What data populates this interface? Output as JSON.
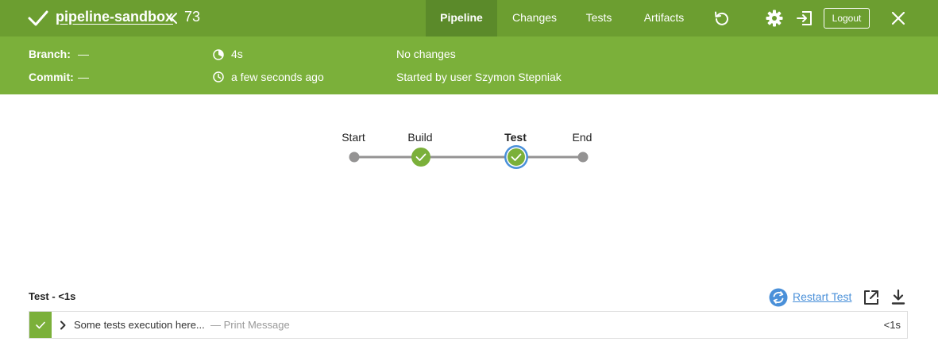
{
  "header": {
    "title": "pipeline-sandbox",
    "run_number": "73",
    "tabs": [
      {
        "label": "Pipeline",
        "active": true
      },
      {
        "label": "Changes",
        "active": false
      },
      {
        "label": "Tests",
        "active": false
      },
      {
        "label": "Artifacts",
        "active": false
      }
    ],
    "logout_label": "Logout",
    "icons": [
      "check-icon",
      "chevron-left-icon",
      "replay-icon",
      "gear-icon",
      "exit-icon",
      "close-icon"
    ]
  },
  "info": {
    "branch_label": "Branch:",
    "branch_value": "—",
    "commit_label": "Commit:",
    "commit_value": "—",
    "duration": "4s",
    "time_ago": "a few seconds ago",
    "changes": "No changes",
    "started_by": "Started by user Szymon Stepniak"
  },
  "pipeline": {
    "stages": [
      {
        "name": "Start",
        "status": "none",
        "selected": false
      },
      {
        "name": "Build",
        "status": "success",
        "selected": false
      },
      {
        "name": "Test",
        "status": "success",
        "selected": true
      },
      {
        "name": "End",
        "status": "none",
        "selected": false
      }
    ]
  },
  "log": {
    "section_title": "Test - <1s",
    "restart_label": "Restart Test",
    "step_text": "Some tests execution here...",
    "step_type": "— Print Message",
    "step_duration": "<1s"
  },
  "colors": {
    "topbar": "#6c9e30",
    "infobar": "#7bb03a",
    "active_tab": "#5b8a2a",
    "success": "#7bb03a",
    "selected_ring": "#4a90d9",
    "link": "#4a90d9",
    "connector": "#949393"
  }
}
